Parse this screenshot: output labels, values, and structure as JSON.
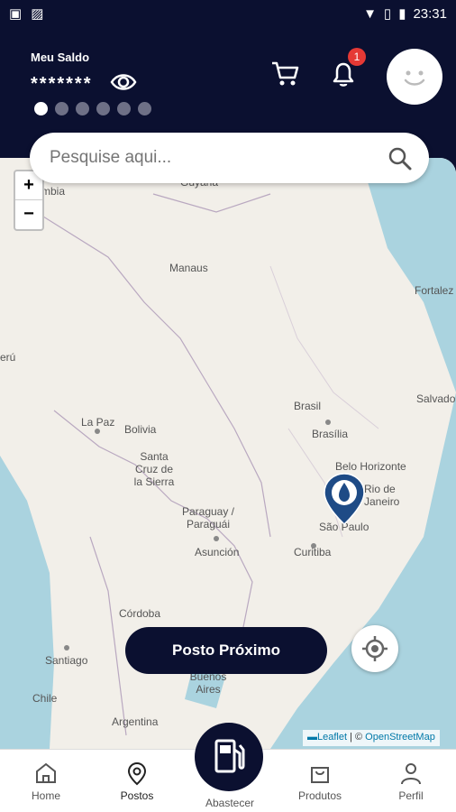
{
  "status_bar": {
    "time": "23:31"
  },
  "header": {
    "balance_label": "Meu Saldo",
    "balance_value": "*******",
    "notification_count": "1",
    "carousel_dots": 6,
    "active_dot": 0
  },
  "search": {
    "placeholder": "Pesquise aqui..."
  },
  "map": {
    "labels": {
      "guyana": "Guyana",
      "colombia": "mbia",
      "manaus": "Manaus",
      "fortaleza": "Fortalez",
      "peru": "erú",
      "salvador": "Salvado",
      "brasil": "Brasil",
      "brasilia": "Brasília",
      "la_paz": "La Paz",
      "bolivia": "Bolivia",
      "santa_cruz": "Santa Cruz de la Sierra",
      "belo_horizonte": "Belo Horizonte",
      "rio": "Rio de Janeiro",
      "sao_paulo": "São Paulo",
      "paraguay": "Paraguay / Paraguái",
      "curitiba": "Curitiba",
      "asuncion": "Asunción",
      "cordoba": "Córdoba",
      "santiago": "Santiago",
      "buenos_aires": "Buenos Aires",
      "chile": "Chile",
      "argentina": "Argentina"
    },
    "zoom_in": "+",
    "zoom_out": "−",
    "attribution_leaflet": "Leaflet",
    "attribution_sep": " | © ",
    "attribution_osm": "OpenStreetMap"
  },
  "actions": {
    "nearest_station": "Posto Próximo"
  },
  "bottom_nav": {
    "home": "Home",
    "postos": "Postos",
    "abastecer": "Abastecer",
    "produtos": "Produtos",
    "perfil": "Perfil"
  },
  "colors": {
    "brand": "#0b1030",
    "badge": "#e53935",
    "sea": "#aad3df",
    "land": "#f2efe9"
  }
}
